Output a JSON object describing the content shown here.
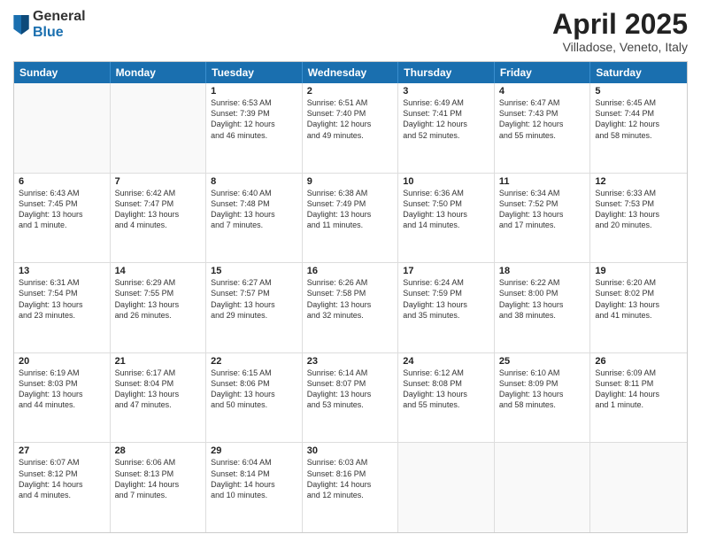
{
  "logo": {
    "general": "General",
    "blue": "Blue"
  },
  "title": "April 2025",
  "subtitle": "Villadose, Veneto, Italy",
  "header_days": [
    "Sunday",
    "Monday",
    "Tuesday",
    "Wednesday",
    "Thursday",
    "Friday",
    "Saturday"
  ],
  "rows": [
    [
      {
        "day": "",
        "lines": [],
        "empty": true
      },
      {
        "day": "",
        "lines": [],
        "empty": true
      },
      {
        "day": "1",
        "lines": [
          "Sunrise: 6:53 AM",
          "Sunset: 7:39 PM",
          "Daylight: 12 hours",
          "and 46 minutes."
        ]
      },
      {
        "day": "2",
        "lines": [
          "Sunrise: 6:51 AM",
          "Sunset: 7:40 PM",
          "Daylight: 12 hours",
          "and 49 minutes."
        ]
      },
      {
        "day": "3",
        "lines": [
          "Sunrise: 6:49 AM",
          "Sunset: 7:41 PM",
          "Daylight: 12 hours",
          "and 52 minutes."
        ]
      },
      {
        "day": "4",
        "lines": [
          "Sunrise: 6:47 AM",
          "Sunset: 7:43 PM",
          "Daylight: 12 hours",
          "and 55 minutes."
        ]
      },
      {
        "day": "5",
        "lines": [
          "Sunrise: 6:45 AM",
          "Sunset: 7:44 PM",
          "Daylight: 12 hours",
          "and 58 minutes."
        ]
      }
    ],
    [
      {
        "day": "6",
        "lines": [
          "Sunrise: 6:43 AM",
          "Sunset: 7:45 PM",
          "Daylight: 13 hours",
          "and 1 minute."
        ]
      },
      {
        "day": "7",
        "lines": [
          "Sunrise: 6:42 AM",
          "Sunset: 7:47 PM",
          "Daylight: 13 hours",
          "and 4 minutes."
        ]
      },
      {
        "day": "8",
        "lines": [
          "Sunrise: 6:40 AM",
          "Sunset: 7:48 PM",
          "Daylight: 13 hours",
          "and 7 minutes."
        ]
      },
      {
        "day": "9",
        "lines": [
          "Sunrise: 6:38 AM",
          "Sunset: 7:49 PM",
          "Daylight: 13 hours",
          "and 11 minutes."
        ]
      },
      {
        "day": "10",
        "lines": [
          "Sunrise: 6:36 AM",
          "Sunset: 7:50 PM",
          "Daylight: 13 hours",
          "and 14 minutes."
        ]
      },
      {
        "day": "11",
        "lines": [
          "Sunrise: 6:34 AM",
          "Sunset: 7:52 PM",
          "Daylight: 13 hours",
          "and 17 minutes."
        ]
      },
      {
        "day": "12",
        "lines": [
          "Sunrise: 6:33 AM",
          "Sunset: 7:53 PM",
          "Daylight: 13 hours",
          "and 20 minutes."
        ]
      }
    ],
    [
      {
        "day": "13",
        "lines": [
          "Sunrise: 6:31 AM",
          "Sunset: 7:54 PM",
          "Daylight: 13 hours",
          "and 23 minutes."
        ]
      },
      {
        "day": "14",
        "lines": [
          "Sunrise: 6:29 AM",
          "Sunset: 7:55 PM",
          "Daylight: 13 hours",
          "and 26 minutes."
        ]
      },
      {
        "day": "15",
        "lines": [
          "Sunrise: 6:27 AM",
          "Sunset: 7:57 PM",
          "Daylight: 13 hours",
          "and 29 minutes."
        ]
      },
      {
        "day": "16",
        "lines": [
          "Sunrise: 6:26 AM",
          "Sunset: 7:58 PM",
          "Daylight: 13 hours",
          "and 32 minutes."
        ]
      },
      {
        "day": "17",
        "lines": [
          "Sunrise: 6:24 AM",
          "Sunset: 7:59 PM",
          "Daylight: 13 hours",
          "and 35 minutes."
        ]
      },
      {
        "day": "18",
        "lines": [
          "Sunrise: 6:22 AM",
          "Sunset: 8:00 PM",
          "Daylight: 13 hours",
          "and 38 minutes."
        ]
      },
      {
        "day": "19",
        "lines": [
          "Sunrise: 6:20 AM",
          "Sunset: 8:02 PM",
          "Daylight: 13 hours",
          "and 41 minutes."
        ]
      }
    ],
    [
      {
        "day": "20",
        "lines": [
          "Sunrise: 6:19 AM",
          "Sunset: 8:03 PM",
          "Daylight: 13 hours",
          "and 44 minutes."
        ]
      },
      {
        "day": "21",
        "lines": [
          "Sunrise: 6:17 AM",
          "Sunset: 8:04 PM",
          "Daylight: 13 hours",
          "and 47 minutes."
        ]
      },
      {
        "day": "22",
        "lines": [
          "Sunrise: 6:15 AM",
          "Sunset: 8:06 PM",
          "Daylight: 13 hours",
          "and 50 minutes."
        ]
      },
      {
        "day": "23",
        "lines": [
          "Sunrise: 6:14 AM",
          "Sunset: 8:07 PM",
          "Daylight: 13 hours",
          "and 53 minutes."
        ]
      },
      {
        "day": "24",
        "lines": [
          "Sunrise: 6:12 AM",
          "Sunset: 8:08 PM",
          "Daylight: 13 hours",
          "and 55 minutes."
        ]
      },
      {
        "day": "25",
        "lines": [
          "Sunrise: 6:10 AM",
          "Sunset: 8:09 PM",
          "Daylight: 13 hours",
          "and 58 minutes."
        ]
      },
      {
        "day": "26",
        "lines": [
          "Sunrise: 6:09 AM",
          "Sunset: 8:11 PM",
          "Daylight: 14 hours",
          "and 1 minute."
        ]
      }
    ],
    [
      {
        "day": "27",
        "lines": [
          "Sunrise: 6:07 AM",
          "Sunset: 8:12 PM",
          "Daylight: 14 hours",
          "and 4 minutes."
        ]
      },
      {
        "day": "28",
        "lines": [
          "Sunrise: 6:06 AM",
          "Sunset: 8:13 PM",
          "Daylight: 14 hours",
          "and 7 minutes."
        ]
      },
      {
        "day": "29",
        "lines": [
          "Sunrise: 6:04 AM",
          "Sunset: 8:14 PM",
          "Daylight: 14 hours",
          "and 10 minutes."
        ]
      },
      {
        "day": "30",
        "lines": [
          "Sunrise: 6:03 AM",
          "Sunset: 8:16 PM",
          "Daylight: 14 hours",
          "and 12 minutes."
        ]
      },
      {
        "day": "",
        "lines": [],
        "empty": true
      },
      {
        "day": "",
        "lines": [],
        "empty": true
      },
      {
        "day": "",
        "lines": [],
        "empty": true
      }
    ]
  ]
}
